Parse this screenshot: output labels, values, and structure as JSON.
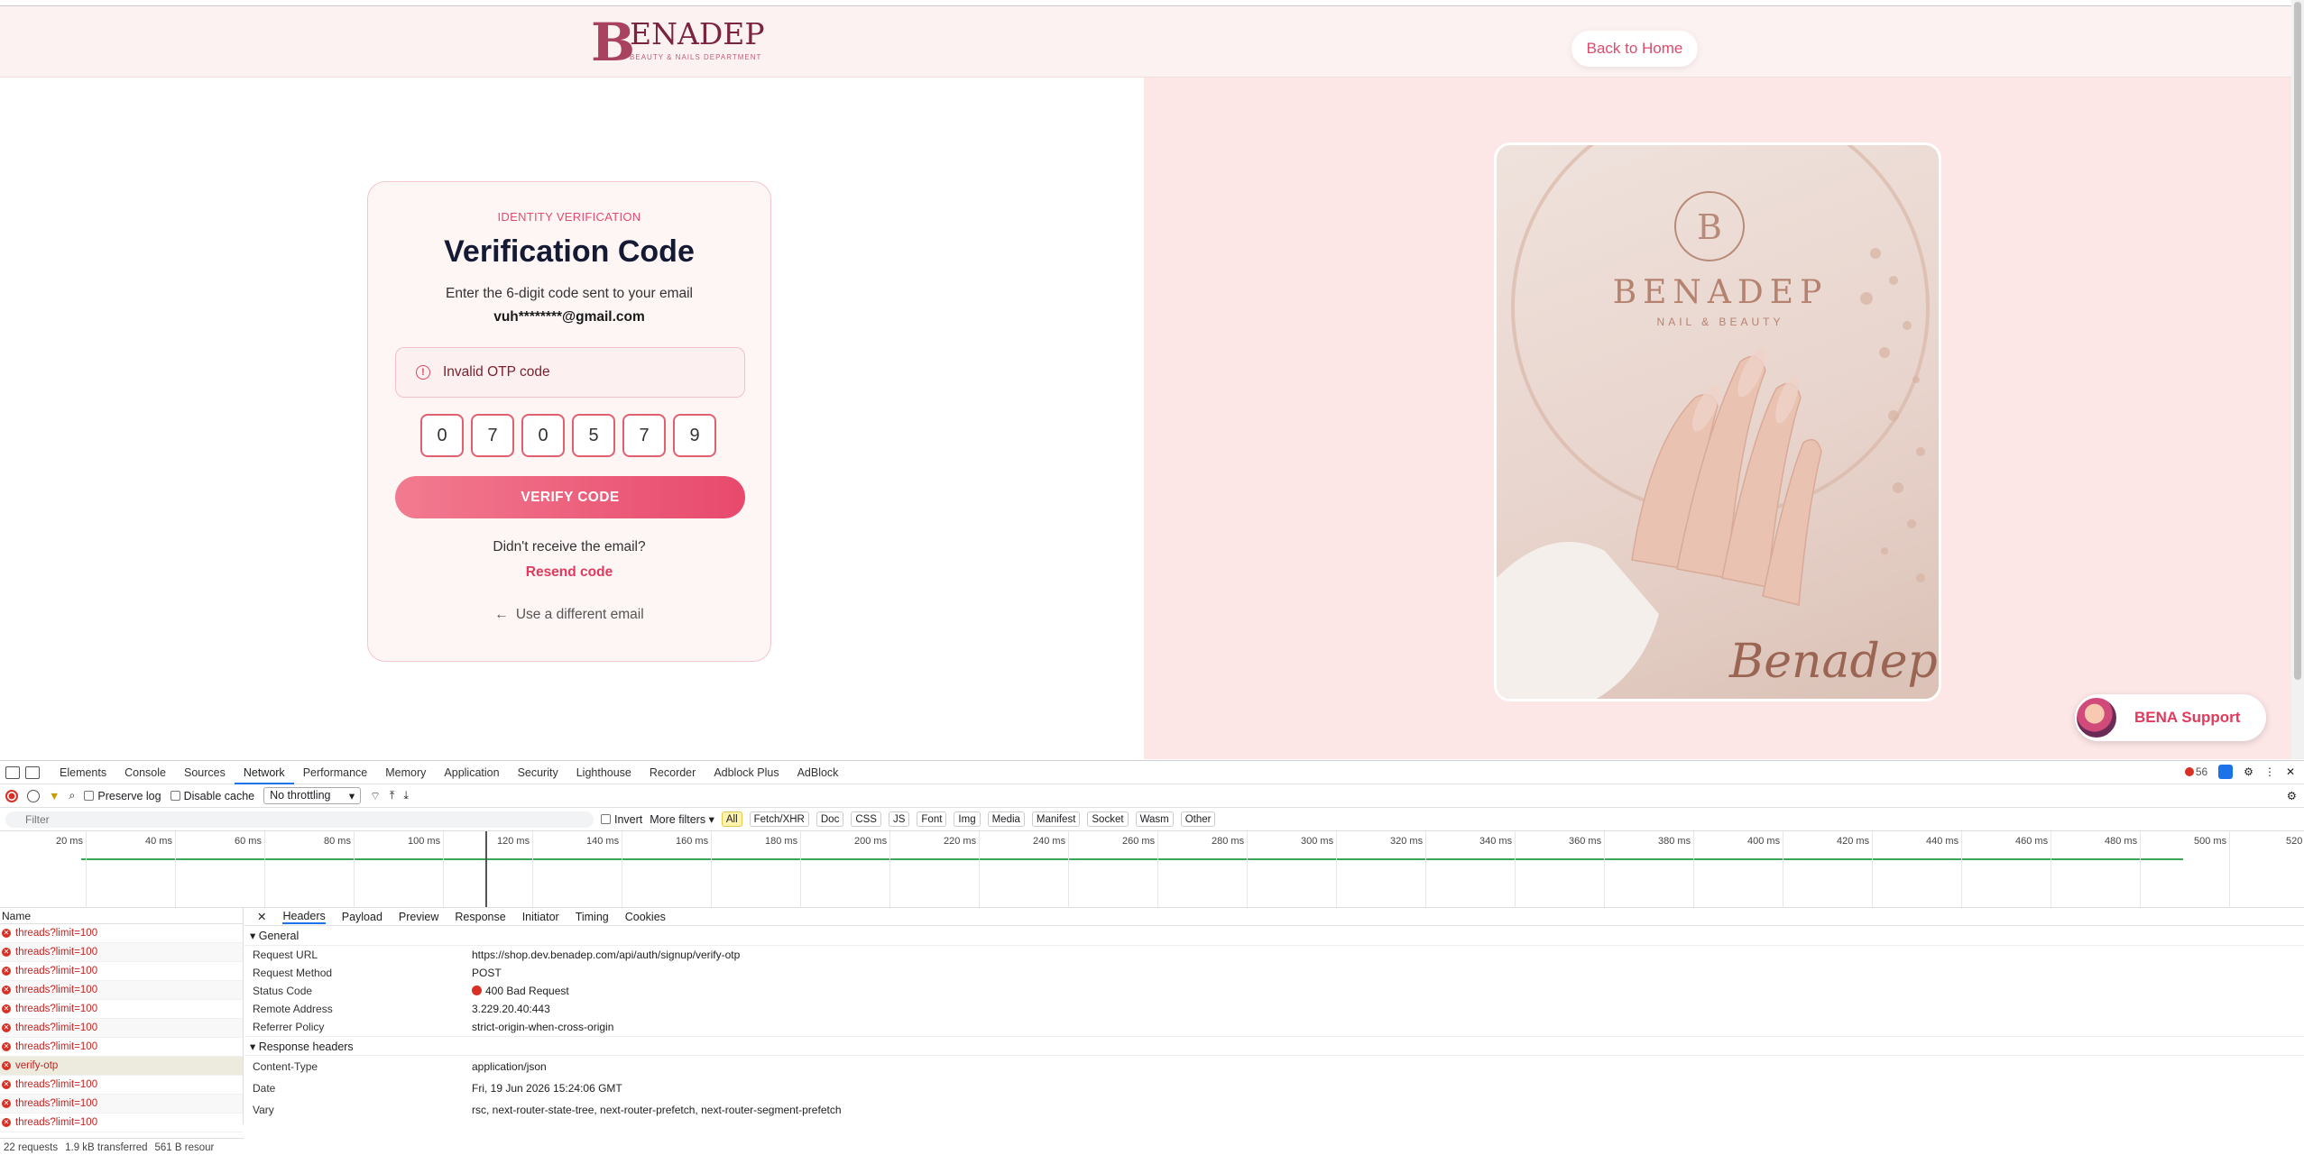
{
  "header": {
    "logo_letter": "B",
    "logo_text": "ENADEP",
    "logo_tagline": "BEAUTY & NAILS DEPARTMENT",
    "back_button": "Back to Home"
  },
  "card": {
    "eyebrow": "IDENTITY VERIFICATION",
    "title": "Verification Code",
    "subtitle": "Enter the 6-digit code sent to your email",
    "email": "vuh********@gmail.com",
    "error_icon": "alert-circle-icon",
    "error_message": "Invalid OTP code",
    "otp_digits": [
      "0",
      "7",
      "0",
      "5",
      "7",
      "9"
    ],
    "verify_button": "VERIFY CODE",
    "didnt_receive": "Didn't receive the email?",
    "resend": "Resend code",
    "different_email": "Use a different email",
    "back_arrow": "←"
  },
  "hero_image": {
    "brand": "BENADEP",
    "brand_sub": "NAIL & BEAUTY",
    "signature": "Benadep"
  },
  "support": {
    "label": "BENA Support"
  },
  "devtools": {
    "tabs": [
      "Elements",
      "Console",
      "Sources",
      "Network",
      "Performance",
      "Memory",
      "Application",
      "Security",
      "Lighthouse",
      "Recorder",
      "Adblock Plus",
      "AdBlock"
    ],
    "active_tab": "Network",
    "error_count": "56",
    "toolbar": {
      "preserve_log": "Preserve log",
      "disable_cache": "Disable cache",
      "throttling": "No throttling"
    },
    "filter": {
      "placeholder": "Filter",
      "invert": "Invert",
      "more_filters": "More filters",
      "types": [
        "All",
        "Fetch/XHR",
        "Doc",
        "CSS",
        "JS",
        "Font",
        "Img",
        "Media",
        "Manifest",
        "Socket",
        "Wasm",
        "Other"
      ]
    },
    "timeline_ticks": [
      "20 ms",
      "40 ms",
      "60 ms",
      "80 ms",
      "100 ms",
      "120 ms",
      "140 ms",
      "160 ms",
      "180 ms",
      "200 ms",
      "220 ms",
      "240 ms",
      "260 ms",
      "280 ms",
      "300 ms",
      "320 ms",
      "340 ms",
      "360 ms",
      "380 ms",
      "400 ms",
      "420 ms",
      "440 ms",
      "460 ms",
      "480 ms",
      "500 ms",
      "520"
    ],
    "name_header": "Name",
    "requests": [
      "threads?limit=100",
      "threads?limit=100",
      "threads?limit=100",
      "threads?limit=100",
      "threads?limit=100",
      "threads?limit=100",
      "threads?limit=100",
      "verify-otp",
      "threads?limit=100",
      "threads?limit=100",
      "threads?limit=100"
    ],
    "detail_tabs": [
      "Headers",
      "Payload",
      "Preview",
      "Response",
      "Initiator",
      "Timing",
      "Cookies"
    ],
    "general_title": "General",
    "general": [
      {
        "k": "Request URL",
        "v": "https://shop.dev.benadep.com/api/auth/signup/verify-otp"
      },
      {
        "k": "Request Method",
        "v": "POST"
      },
      {
        "k": "Status Code",
        "v": "400 Bad Request"
      },
      {
        "k": "Remote Address",
        "v": "3.229.20.40:443"
      },
      {
        "k": "Referrer Policy",
        "v": "strict-origin-when-cross-origin"
      }
    ],
    "response_title": "Response headers",
    "response": [
      {
        "k": "Content-Type",
        "v": "application/json"
      },
      {
        "k": "Date",
        "v": "Fri, 19 Jun 2026 15:24:06 GMT"
      },
      {
        "k": "Vary",
        "v": "rsc, next-router-state-tree, next-router-prefetch, next-router-segment-prefetch"
      }
    ],
    "status": {
      "requests": "22 requests",
      "transferred": "1.9 kB transferred",
      "resources": "561 B resour"
    }
  },
  "colors": {
    "accent": "#e8496c",
    "header_bg": "#fdf2f2",
    "right_panel_bg": "#fce6e6",
    "error": "#d93025"
  }
}
